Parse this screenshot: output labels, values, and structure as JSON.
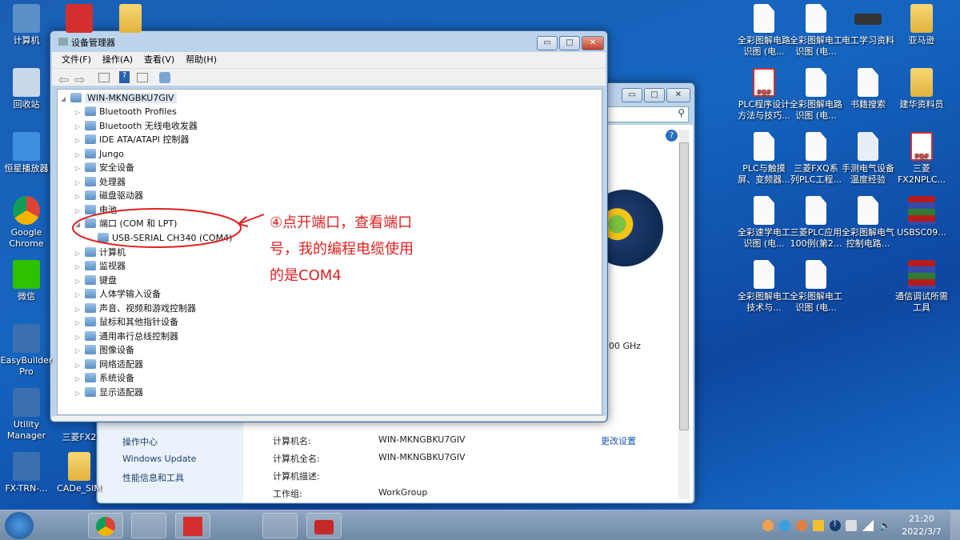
{
  "desktop_left": [
    {
      "label": "计算机",
      "type": "computer"
    },
    {
      "label": "回收站",
      "type": "recycle"
    },
    {
      "label": "恒星播放器",
      "type": "player"
    },
    {
      "label": "Google Chrome",
      "type": "chrome"
    },
    {
      "label": "微信",
      "type": "wechat"
    },
    {
      "label": "EasyBuilder Pro",
      "type": "app"
    },
    {
      "label": "Utility Manager",
      "type": "app"
    },
    {
      "label": "FX-TRN-...",
      "type": "app"
    }
  ],
  "desktop_left2": [
    {
      "label": "三菱FX2"
    },
    {
      "label": "CADe_SIM"
    }
  ],
  "desktop_right": [
    [
      "全彩图解电路识图 (电...",
      "全彩图解电工识图 (电...",
      "电工学习资料",
      "亚马逊"
    ],
    [
      "PLC程序设计方法与技巧...",
      "全彩图解电路识图 (电...",
      "书籍搜索",
      "建华资料员"
    ],
    [
      "PLC与触摸屏、变频器...",
      "三菱FXQ系列PLC工程...",
      "手测电气设备温度经验",
      "三菱FX2NPLC..."
    ],
    [
      "全彩速学电工识图 (电...",
      "三菱PLC应用100例(第2...",
      "全彩图解电气控制电路...",
      "USBSC09..."
    ],
    [
      "全彩图解电工技术与...",
      "全彩图解电工识图 (电...",
      "",
      "通信调试所需工具"
    ]
  ],
  "sysinfo": {
    "left_links": [
      "操作中心",
      "Windows Update",
      "性能信息和工具"
    ],
    "cpu_fragment": "00 GHz",
    "change_settings": "更改设置",
    "rows": [
      {
        "label": "计算机名:",
        "value": "WIN-MKNGBKU7GIV"
      },
      {
        "label": "计算机全名:",
        "value": "WIN-MKNGBKU7GIV"
      },
      {
        "label": "计算机描述:",
        "value": ""
      },
      {
        "label": "工作组:",
        "value": "WorkGroup"
      }
    ]
  },
  "devmgr": {
    "title": "设备管理器",
    "menu": [
      "文件(F)",
      "操作(A)",
      "查看(V)",
      "帮助(H)"
    ],
    "root": "WIN-MKNGBKU7GIV",
    "items": [
      "Bluetooth Profiles",
      "Bluetooth 无线电收发器",
      "IDE ATA/ATAPI 控制器",
      "Jungo",
      "安全设备",
      "处理器",
      "磁盘驱动器",
      "电池",
      "端口 (COM 和 LPT)",
      "USB-SERIAL CH340 (COM4)",
      "计算机",
      "监视器",
      "键盘",
      "人体学输入设备",
      "声音、视频和游戏控制器",
      "鼠标和其他指针设备",
      "通用串行总线控制器",
      "图像设备",
      "网络适配器",
      "系统设备",
      "显示适配器"
    ]
  },
  "annotation": {
    "lines": [
      "④点开端口，查看端口",
      "号，我的编程电缆使用",
      "的是COM4"
    ],
    "color": "#e02020"
  },
  "taskbar": {
    "time": "21:20",
    "date": "2022/3/7"
  }
}
